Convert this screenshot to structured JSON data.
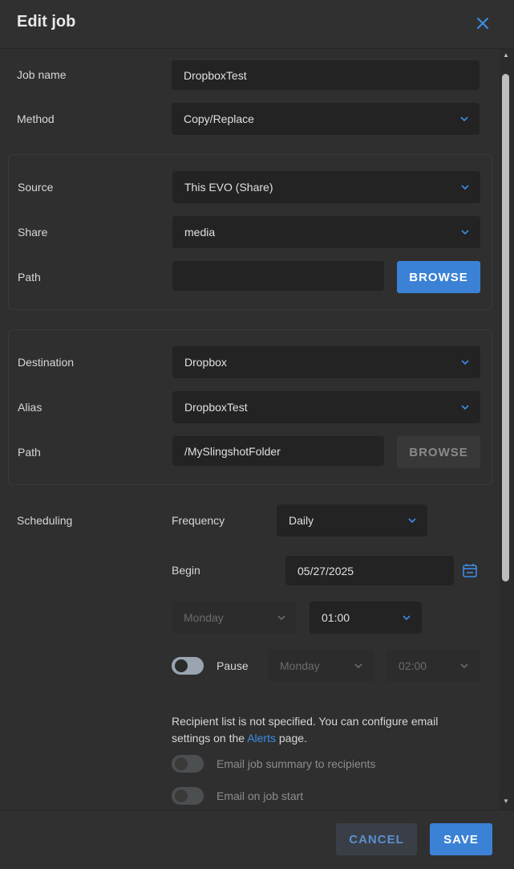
{
  "dialog": {
    "title": "Edit job",
    "close_icon": "close-icon"
  },
  "job": {
    "name_label": "Job name",
    "name_value": "DropboxTest",
    "method_label": "Method",
    "method_value": "Copy/Replace"
  },
  "source": {
    "source_label": "Source",
    "source_value": "This EVO (Share)",
    "share_label": "Share",
    "share_value": "media",
    "path_label": "Path",
    "path_value": "",
    "browse_label": "BROWSE"
  },
  "destination": {
    "destination_label": "Destination",
    "destination_value": "Dropbox",
    "alias_label": "Alias",
    "alias_value": "DropboxTest",
    "path_label": "Path",
    "path_value": "/MySlingshotFolder",
    "browse_label": "BROWSE"
  },
  "scheduling": {
    "label": "Scheduling",
    "frequency_label": "Frequency",
    "frequency_value": "Daily",
    "begin_label": "Begin",
    "begin_value": "05/27/2025",
    "day_value": "Monday",
    "time_value": "01:00",
    "pause_label": "Pause",
    "pause_on": false,
    "pause_day_value": "Monday",
    "pause_time_value": "02:00"
  },
  "notifications": {
    "note_prefix": "Recipient list is not specified. You can configure email settings on the ",
    "note_link": "Alerts",
    "note_suffix": " page.",
    "email_summary_label": "Email job summary to recipients",
    "email_start_label": "Email on job start"
  },
  "footer": {
    "cancel_label": "CANCEL",
    "save_label": "SAVE"
  },
  "colors": {
    "accent": "#3b82d6",
    "background": "#2f2f2f",
    "field": "#232323"
  }
}
